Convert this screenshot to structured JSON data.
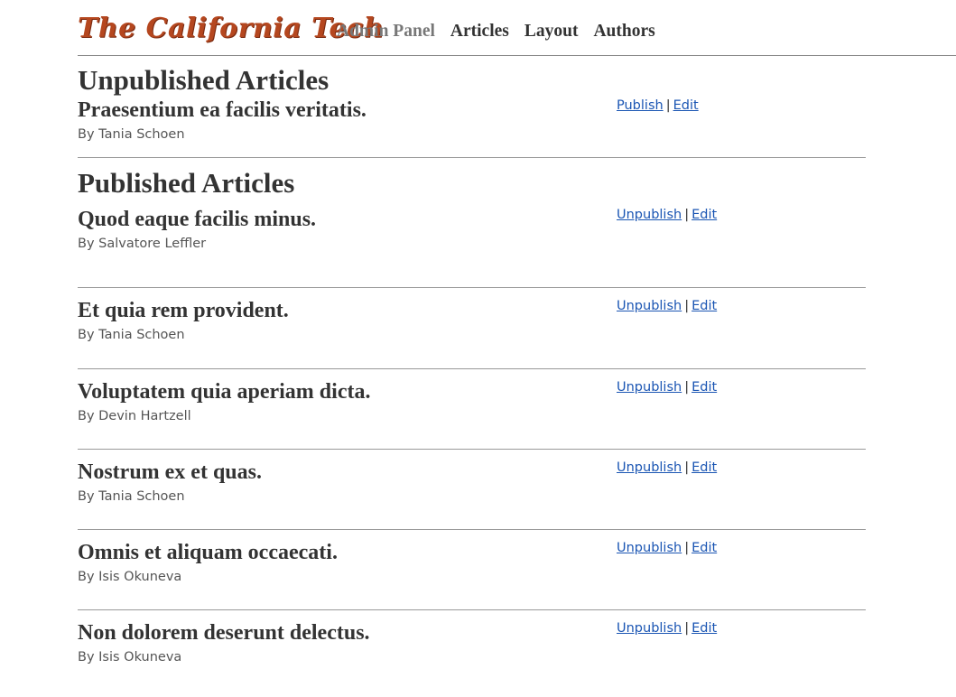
{
  "header": {
    "logo_text": "The California Tech",
    "nav": [
      {
        "label": "Admin Panel"
      },
      {
        "label": "Articles"
      },
      {
        "label": "Layout"
      },
      {
        "label": "Authors"
      }
    ]
  },
  "unpublished": {
    "title": "Unpublished Articles",
    "articles": [
      {
        "title": "Praesentium ea facilis veritatis.",
        "author": "By Tania Schoen",
        "action": "Publish",
        "edit": "Edit",
        "separator": "|"
      }
    ]
  },
  "published": {
    "title": "Published Articles",
    "articles": [
      {
        "title": "Quod eaque facilis minus.",
        "author": "By Salvatore Leffler",
        "action": "Unpublish",
        "edit": "Edit",
        "separator": "|"
      },
      {
        "title": "Et quia rem provident.",
        "author": "By Tania Schoen",
        "action": "Unpublish",
        "edit": "Edit",
        "separator": "|"
      },
      {
        "title": "Voluptatem quia aperiam dicta.",
        "author": "By Devin Hartzell",
        "action": "Unpublish",
        "edit": "Edit",
        "separator": "|"
      },
      {
        "title": "Nostrum ex et quas.",
        "author": "By Tania Schoen",
        "action": "Unpublish",
        "edit": "Edit",
        "separator": "|"
      },
      {
        "title": "Omnis et aliquam occaecati.",
        "author": "By Isis Okuneva",
        "action": "Unpublish",
        "edit": "Edit",
        "separator": "|"
      },
      {
        "title": "Non dolorem deserunt delectus.",
        "author": "By Isis Okuneva",
        "action": "Unpublish",
        "edit": "Edit",
        "separator": "|"
      }
    ]
  },
  "colors": {
    "link": "#1a55b3",
    "logo": "#b5471f",
    "text": "#333333",
    "muted": "#777777"
  }
}
